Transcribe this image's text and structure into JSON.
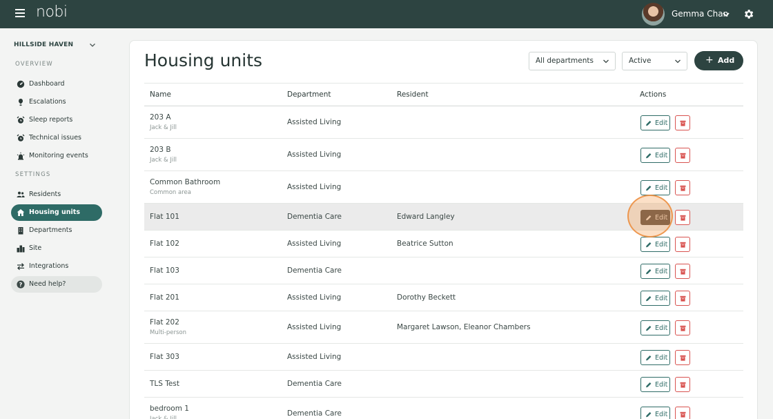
{
  "app": {
    "logo": "nobi"
  },
  "user": {
    "name": "Gemma Chan"
  },
  "sidebar": {
    "org_name": "HILLSIDE HAVEN",
    "overview_label": "OVERVIEW",
    "settings_label": "SETTINGS",
    "overview_items": [
      {
        "label": "Dashboard",
        "icon": "gauge-icon"
      },
      {
        "label": "Escalations",
        "icon": "alert-pin-icon"
      },
      {
        "label": "Sleep reports",
        "icon": "alarm-clock-icon"
      },
      {
        "label": "Technical issues",
        "icon": "alarm-clock-icon"
      },
      {
        "label": "Monitoring events",
        "icon": "siren-icon"
      }
    ],
    "settings_items": [
      {
        "label": "Residents",
        "icon": "people-icon"
      },
      {
        "label": "Housing units",
        "icon": "house-icon",
        "active": true
      },
      {
        "label": "Departments",
        "icon": "building-icon"
      },
      {
        "label": "Site",
        "icon": "city-icon"
      },
      {
        "label": "Integrations",
        "icon": "arrows-exchange-icon"
      }
    ],
    "help_label": "Need help?"
  },
  "page": {
    "title": "Housing units",
    "department_filter": "All departments",
    "status_filter": "Active",
    "add_label": "Add"
  },
  "table": {
    "columns": [
      "Name",
      "Department",
      "Resident",
      "Actions"
    ],
    "edit_label": "Edit",
    "rows": [
      {
        "name": "203 A",
        "subtitle": "Jack & Jill",
        "department": "Assisted Living",
        "resident": ""
      },
      {
        "name": "203 B",
        "subtitle": "Jack & Jill",
        "department": "Assisted Living",
        "resident": ""
      },
      {
        "name": "Common Bathroom",
        "subtitle": "Common area",
        "department": "Assisted Living",
        "resident": ""
      },
      {
        "name": "Flat 101",
        "subtitle": "",
        "department": "Dementia Care",
        "resident": "Edward Langley"
      },
      {
        "name": "Flat 102",
        "subtitle": "",
        "department": "Assisted Living",
        "resident": "Beatrice Sutton"
      },
      {
        "name": "Flat 103",
        "subtitle": "",
        "department": "Dementia Care",
        "resident": ""
      },
      {
        "name": "Flat 201",
        "subtitle": "",
        "department": "Assisted Living",
        "resident": "Dorothy Beckett"
      },
      {
        "name": "Flat 202",
        "subtitle": "Multi-person",
        "department": "Assisted Living",
        "resident": "Margaret Lawson, Eleanor Chambers"
      },
      {
        "name": "Flat 303",
        "subtitle": "",
        "department": "Assisted Living",
        "resident": ""
      },
      {
        "name": "TLS Test",
        "subtitle": "",
        "department": "Dementia Care",
        "resident": ""
      },
      {
        "name": "bedroom 1",
        "subtitle": "Jack & Jill",
        "department": "Dementia Care",
        "resident": ""
      }
    ]
  },
  "colors": {
    "topbar": "#2d4441",
    "accent": "#2e6b66",
    "danger": "#d8524f",
    "highlight": "#f0a050"
  }
}
